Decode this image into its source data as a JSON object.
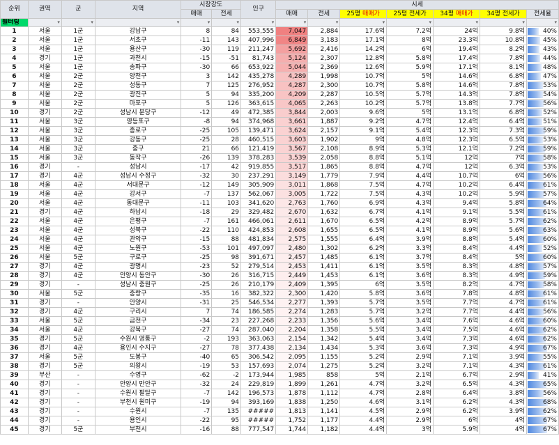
{
  "headers": {
    "rank": "순위",
    "region": "권역",
    "tier": "군",
    "area": "지역",
    "strength": "시장강도",
    "strength_sale": "매매",
    "strength_jeonse": "전세",
    "population": "인구",
    "price": "시세",
    "price_sale": "매매",
    "price_jeonse": "전세",
    "p25_sale_a": "25평 ",
    "p25_sale_b": "매매가",
    "p25_jeonse_a": "25평 ",
    "p25_jeonse_b": "전세가",
    "p34_sale_a": "34평 ",
    "p34_sale_b": "매매가",
    "p34_jeonse_a": "34평 ",
    "p34_jeonse_b": "전세가",
    "ratio": "전세율"
  },
  "filter_label": "필터링",
  "filter_arrow": "▾",
  "colors": {
    "header_bg": "#dfe3ea",
    "yellow": "#ffff00",
    "red_text": "#e00000",
    "filter_green": "#00d96a",
    "bar_blue": "#4f88e0",
    "heat_max": "#f08080",
    "heat_min": "#ffffff"
  },
  "rows": [
    {
      "rank": "1",
      "region": "서울",
      "tier": "1군",
      "area": "강남구",
      "s_sale": "8",
      "s_jeonse": "84",
      "pop": "553,555",
      "sale": "7,047",
      "jeonse": "2,884",
      "p25s": "17.6억",
      "p25j": "7.2억",
      "p34s": "24억",
      "p34j": "9.8억",
      "ratio": "40%",
      "ratio_v": 40,
      "sale_v": 7047
    },
    {
      "rank": "2",
      "region": "서울",
      "tier": "1군",
      "area": "서초구",
      "s_sale": "-11",
      "s_jeonse": "143",
      "pop": "407,996",
      "sale": "6,849",
      "jeonse": "3,183",
      "p25s": "17.1억",
      "p25j": "8억",
      "p34s": "23.3억",
      "p34j": "10.8억",
      "ratio": "45%",
      "ratio_v": 45,
      "sale_v": 6849
    },
    {
      "rank": "3",
      "region": "서울",
      "tier": "1군",
      "area": "용산구",
      "s_sale": "-30",
      "s_jeonse": "119",
      "pop": "211,247",
      "sale": "5,692",
      "jeonse": "2,416",
      "p25s": "14.2억",
      "p25j": "6억",
      "p34s": "19.4억",
      "p34j": "8.2억",
      "ratio": "43%",
      "ratio_v": 43,
      "sale_v": 5692
    },
    {
      "rank": "4",
      "region": "경기",
      "tier": "1군",
      "area": "과천시",
      "s_sale": "-15",
      "s_jeonse": "-51",
      "pop": "81,743",
      "sale": "5,124",
      "jeonse": "2,307",
      "p25s": "12.8억",
      "p25j": "5.8억",
      "p34s": "17.4억",
      "p34j": "7.8억",
      "ratio": "44%",
      "ratio_v": 44,
      "sale_v": 5124
    },
    {
      "rank": "5",
      "region": "서울",
      "tier": "1군",
      "area": "송파구",
      "s_sale": "-30",
      "s_jeonse": "66",
      "pop": "653,922",
      "sale": "5,044",
      "jeonse": "2,369",
      "p25s": "12.6억",
      "p25j": "5.9억",
      "p34s": "17.1억",
      "p34j": "8.1억",
      "ratio": "48%",
      "ratio_v": 48,
      "sale_v": 5044
    },
    {
      "rank": "6",
      "region": "서울",
      "tier": "2군",
      "area": "양천구",
      "s_sale": "3",
      "s_jeonse": "142",
      "pop": "435,278",
      "sale": "4,289",
      "jeonse": "1,998",
      "p25s": "10.7억",
      "p25j": "5억",
      "p34s": "14.6억",
      "p34j": "6.8억",
      "ratio": "47%",
      "ratio_v": 47,
      "sale_v": 4289
    },
    {
      "rank": "7",
      "region": "서울",
      "tier": "2군",
      "area": "성동구",
      "s_sale": "7",
      "s_jeonse": "125",
      "pop": "276,952",
      "sale": "4,287",
      "jeonse": "2,300",
      "p25s": "10.7억",
      "p25j": "5.8억",
      "p34s": "14.6억",
      "p34j": "7.8억",
      "ratio": "53%",
      "ratio_v": 53,
      "sale_v": 4287
    },
    {
      "rank": "8",
      "region": "서울",
      "tier": "2군",
      "area": "광진구",
      "s_sale": "5",
      "s_jeonse": "94",
      "pop": "335,200",
      "sale": "4,209",
      "jeonse": "2,287",
      "p25s": "10.5억",
      "p25j": "5.7억",
      "p34s": "14.3억",
      "p34j": "7.8억",
      "ratio": "54%",
      "ratio_v": 54,
      "sale_v": 4209
    },
    {
      "rank": "9",
      "region": "서울",
      "tier": "2군",
      "area": "마포구",
      "s_sale": "5",
      "s_jeonse": "126",
      "pop": "363,615",
      "sale": "4,065",
      "jeonse": "2,263",
      "p25s": "10.2억",
      "p25j": "5.7억",
      "p34s": "13.8억",
      "p34j": "7.7억",
      "ratio": "56%",
      "ratio_v": 56,
      "sale_v": 4065
    },
    {
      "rank": "10",
      "region": "경기",
      "tier": "2군",
      "area": "성남시 분당구",
      "s_sale": "-12",
      "s_jeonse": "49",
      "pop": "472,385",
      "sale": "3,844",
      "jeonse": "2,003",
      "p25s": "9.6억",
      "p25j": "5억",
      "p34s": "13.1억",
      "p34j": "6.8억",
      "ratio": "52%",
      "ratio_v": 52,
      "sale_v": 3844
    },
    {
      "rank": "11",
      "region": "서울",
      "tier": "3군",
      "area": "영등포구",
      "s_sale": "-8",
      "s_jeonse": "94",
      "pop": "374,968",
      "sale": "3,661",
      "jeonse": "1,887",
      "p25s": "9.2억",
      "p25j": "4.7억",
      "p34s": "12.4억",
      "p34j": "6.4억",
      "ratio": "51%",
      "ratio_v": 51,
      "sale_v": 3661
    },
    {
      "rank": "12",
      "region": "서울",
      "tier": "3군",
      "area": "종로구",
      "s_sale": "-25",
      "s_jeonse": "105",
      "pop": "139,471",
      "sale": "3,624",
      "jeonse": "2,157",
      "p25s": "9.1억",
      "p25j": "5.4억",
      "p34s": "12.3억",
      "p34j": "7.3억",
      "ratio": "59%",
      "ratio_v": 59,
      "sale_v": 3624
    },
    {
      "rank": "13",
      "region": "서울",
      "tier": "3군",
      "area": "강동구",
      "s_sale": "-25",
      "s_jeonse": "28",
      "pop": "460,515",
      "sale": "3,603",
      "jeonse": "1,902",
      "p25s": "9억",
      "p25j": "4.8억",
      "p34s": "12.3억",
      "p34j": "6.5억",
      "ratio": "53%",
      "ratio_v": 53,
      "sale_v": 3603
    },
    {
      "rank": "14",
      "region": "서울",
      "tier": "3군",
      "area": "중구",
      "s_sale": "21",
      "s_jeonse": "66",
      "pop": "121,419",
      "sale": "3,567",
      "jeonse": "2,108",
      "p25s": "8.9억",
      "p25j": "5.3억",
      "p34s": "12.1억",
      "p34j": "7.2억",
      "ratio": "59%",
      "ratio_v": 59,
      "sale_v": 3567
    },
    {
      "rank": "15",
      "region": "서울",
      "tier": "3군",
      "area": "동작구",
      "s_sale": "-26",
      "s_jeonse": "139",
      "pop": "378,283",
      "sale": "3,539",
      "jeonse": "2,058",
      "p25s": "8.8억",
      "p25j": "5.1억",
      "p34s": "12억",
      "p34j": "7억",
      "ratio": "58%",
      "ratio_v": 58,
      "sale_v": 3539
    },
    {
      "rank": "16",
      "region": "경기",
      "tier": "-",
      "area": "성남시",
      "s_sale": "-17",
      "s_jeonse": "42",
      "pop": "919,855",
      "sale": "3,517",
      "jeonse": "1,865",
      "p25s": "8.8억",
      "p25j": "4.7억",
      "p34s": "12억",
      "p34j": "6.3억",
      "ratio": "53%",
      "ratio_v": 53,
      "sale_v": 3517
    },
    {
      "rank": "17",
      "region": "경기",
      "tier": "4군",
      "area": "성남시 수정구",
      "s_sale": "-32",
      "s_jeonse": "30",
      "pop": "237,291",
      "sale": "3,149",
      "jeonse": "1,779",
      "p25s": "7.9억",
      "p25j": "4.4억",
      "p34s": "10.7억",
      "p34j": "6억",
      "ratio": "56%",
      "ratio_v": 56,
      "sale_v": 3149
    },
    {
      "rank": "18",
      "region": "서울",
      "tier": "4군",
      "area": "서대문구",
      "s_sale": "-12",
      "s_jeonse": "149",
      "pop": "305,909",
      "sale": "3,011",
      "jeonse": "1,868",
      "p25s": "7.5억",
      "p25j": "4.7억",
      "p34s": "10.2억",
      "p34j": "6.4억",
      "ratio": "61%",
      "ratio_v": 61,
      "sale_v": 3011
    },
    {
      "rank": "19",
      "region": "서울",
      "tier": "4군",
      "area": "강서구",
      "s_sale": "-7",
      "s_jeonse": "137",
      "pop": "562,067",
      "sale": "3,005",
      "jeonse": "1,722",
      "p25s": "7.5억",
      "p25j": "4.3억",
      "p34s": "10.2억",
      "p34j": "5.9억",
      "ratio": "57%",
      "ratio_v": 57,
      "sale_v": 3005
    },
    {
      "rank": "20",
      "region": "서울",
      "tier": "4군",
      "area": "동대문구",
      "s_sale": "-11",
      "s_jeonse": "103",
      "pop": "341,620",
      "sale": "2,763",
      "jeonse": "1,760",
      "p25s": "6.9억",
      "p25j": "4.3억",
      "p34s": "9.4억",
      "p34j": "5.8억",
      "ratio": "64%",
      "ratio_v": 64,
      "sale_v": 2763
    },
    {
      "rank": "21",
      "region": "경기",
      "tier": "4군",
      "area": "하남시",
      "s_sale": "-18",
      "s_jeonse": "29",
      "pop": "329,482",
      "sale": "2,670",
      "jeonse": "1,632",
      "p25s": "6.7억",
      "p25j": "4.1억",
      "p34s": "9.1억",
      "p34j": "5.5억",
      "ratio": "61%",
      "ratio_v": 61,
      "sale_v": 2670
    },
    {
      "rank": "22",
      "region": "서울",
      "tier": "4군",
      "area": "은평구",
      "s_sale": "-7",
      "s_jeonse": "161",
      "pop": "466,061",
      "sale": "2,611",
      "jeonse": "1,670",
      "p25s": "6.5억",
      "p25j": "4.2억",
      "p34s": "8.9억",
      "p34j": "5.7억",
      "ratio": "62%",
      "ratio_v": 62,
      "sale_v": 2611
    },
    {
      "rank": "23",
      "region": "서울",
      "tier": "4군",
      "area": "성북구",
      "s_sale": "-22",
      "s_jeonse": "110",
      "pop": "424,853",
      "sale": "2,608",
      "jeonse": "1,655",
      "p25s": "6.5억",
      "p25j": "4.1억",
      "p34s": "8.9억",
      "p34j": "5.6억",
      "ratio": "63%",
      "ratio_v": 63,
      "sale_v": 2608
    },
    {
      "rank": "24",
      "region": "서울",
      "tier": "4군",
      "area": "관악구",
      "s_sale": "-15",
      "s_jeonse": "88",
      "pop": "481,834",
      "sale": "2,575",
      "jeonse": "1,555",
      "p25s": "6.4억",
      "p25j": "3.9억",
      "p34s": "8.8억",
      "p34j": "5.4억",
      "ratio": "60%",
      "ratio_v": 60,
      "sale_v": 2575
    },
    {
      "rank": "25",
      "region": "서울",
      "tier": "4군",
      "area": "노원구",
      "s_sale": "-53",
      "s_jeonse": "101",
      "pop": "497,097",
      "sale": "2,480",
      "jeonse": "1,302",
      "p25s": "6.2억",
      "p25j": "3.3억",
      "p34s": "8.4억",
      "p34j": "4.4억",
      "ratio": "52%",
      "ratio_v": 52,
      "sale_v": 2480
    },
    {
      "rank": "26",
      "region": "서울",
      "tier": "5군",
      "area": "구로구",
      "s_sale": "-25",
      "s_jeonse": "98",
      "pop": "391,671",
      "sale": "2,457",
      "jeonse": "1,485",
      "p25s": "6.1억",
      "p25j": "3.7억",
      "p34s": "8.4억",
      "p34j": "5억",
      "ratio": "60%",
      "ratio_v": 60,
      "sale_v": 2457
    },
    {
      "rank": "27",
      "region": "경기",
      "tier": "4군",
      "area": "광명시",
      "s_sale": "-23",
      "s_jeonse": "52",
      "pop": "279,514",
      "sale": "2,453",
      "jeonse": "1,411",
      "p25s": "6.1억",
      "p25j": "3.5억",
      "p34s": "8.3억",
      "p34j": "4.8억",
      "ratio": "57%",
      "ratio_v": 57,
      "sale_v": 2453
    },
    {
      "rank": "28",
      "region": "경기",
      "tier": "4군",
      "area": "안양시 동안구",
      "s_sale": "-30",
      "s_jeonse": "26",
      "pop": "316,715",
      "sale": "2,449",
      "jeonse": "1,453",
      "p25s": "6.1억",
      "p25j": "3.6억",
      "p34s": "8.3억",
      "p34j": "4.9억",
      "ratio": "59%",
      "ratio_v": 59,
      "sale_v": 2449
    },
    {
      "rank": "29",
      "region": "경기",
      "tier": "-",
      "area": "성남시 중원구",
      "s_sale": "-25",
      "s_jeonse": "26",
      "pop": "210,179",
      "sale": "2,409",
      "jeonse": "1,395",
      "p25s": "6억",
      "p25j": "3.5억",
      "p34s": "8.2억",
      "p34j": "4.7억",
      "ratio": "58%",
      "ratio_v": 58,
      "sale_v": 2409
    },
    {
      "rank": "30",
      "region": "서울",
      "tier": "5군",
      "area": "중랑구",
      "s_sale": "-35",
      "s_jeonse": "16",
      "pop": "382,322",
      "sale": "2,300",
      "jeonse": "1,420",
      "p25s": "5.8억",
      "p25j": "3.6억",
      "p34s": "7.8억",
      "p34j": "4.8억",
      "ratio": "61%",
      "ratio_v": 61,
      "sale_v": 2300
    },
    {
      "rank": "31",
      "region": "경기",
      "tier": "-",
      "area": "안양시",
      "s_sale": "-31",
      "s_jeonse": "25",
      "pop": "546,534",
      "sale": "2,277",
      "jeonse": "1,393",
      "p25s": "5.7억",
      "p25j": "3.5억",
      "p34s": "7.7억",
      "p34j": "4.7억",
      "ratio": "61%",
      "ratio_v": 61,
      "sale_v": 2277
    },
    {
      "rank": "32",
      "region": "경기",
      "tier": "4군",
      "area": "구리시",
      "s_sale": "7",
      "s_jeonse": "74",
      "pop": "186,585",
      "sale": "2,274",
      "jeonse": "1,283",
      "p25s": "5.7억",
      "p25j": "3.2억",
      "p34s": "7.7억",
      "p34j": "4.4억",
      "ratio": "56%",
      "ratio_v": 56,
      "sale_v": 2274
    },
    {
      "rank": "33",
      "region": "서울",
      "tier": "5군",
      "area": "금천구",
      "s_sale": "-34",
      "s_jeonse": "23",
      "pop": "227,268",
      "sale": "2,233",
      "jeonse": "1,356",
      "p25s": "5.6억",
      "p25j": "3.4억",
      "p34s": "7.6억",
      "p34j": "4.6억",
      "ratio": "60%",
      "ratio_v": 60,
      "sale_v": 2233
    },
    {
      "rank": "34",
      "region": "서울",
      "tier": "4군",
      "area": "강북구",
      "s_sale": "-27",
      "s_jeonse": "74",
      "pop": "287,040",
      "sale": "2,204",
      "jeonse": "1,358",
      "p25s": "5.5억",
      "p25j": "3.4억",
      "p34s": "7.5억",
      "p34j": "4.6억",
      "ratio": "62%",
      "ratio_v": 62,
      "sale_v": 2204
    },
    {
      "rank": "35",
      "region": "경기",
      "tier": "5군",
      "area": "수원시 영통구",
      "s_sale": "-2",
      "s_jeonse": "193",
      "pop": "363,063",
      "sale": "2,154",
      "jeonse": "1,342",
      "p25s": "5.4억",
      "p25j": "3.4억",
      "p34s": "7.3억",
      "p34j": "4.6억",
      "ratio": "62%",
      "ratio_v": 62,
      "sale_v": 2154
    },
    {
      "rank": "36",
      "region": "경기",
      "tier": "4군",
      "area": "용인시 수지구",
      "s_sale": "-27",
      "s_jeonse": "78",
      "pop": "377,438",
      "sale": "2,134",
      "jeonse": "1,434",
      "p25s": "5.3억",
      "p25j": "3.6억",
      "p34s": "7.3억",
      "p34j": "4.9억",
      "ratio": "67%",
      "ratio_v": 67,
      "sale_v": 2134
    },
    {
      "rank": "37",
      "region": "서울",
      "tier": "5군",
      "area": "도봉구",
      "s_sale": "-40",
      "s_jeonse": "65",
      "pop": "306,542",
      "sale": "2,095",
      "jeonse": "1,155",
      "p25s": "5.2억",
      "p25j": "2.9억",
      "p34s": "7.1억",
      "p34j": "3.9억",
      "ratio": "55%",
      "ratio_v": 55,
      "sale_v": 2095
    },
    {
      "rank": "38",
      "region": "경기",
      "tier": "5군",
      "area": "의왕시",
      "s_sale": "-19",
      "s_jeonse": "53",
      "pop": "157,693",
      "sale": "2,074",
      "jeonse": "1,275",
      "p25s": "5.2억",
      "p25j": "3.2억",
      "p34s": "7.1억",
      "p34j": "4.3억",
      "ratio": "61%",
      "ratio_v": 61,
      "sale_v": 2074
    },
    {
      "rank": "39",
      "region": "부산",
      "tier": "-",
      "area": "수영구",
      "s_sale": "-62",
      "s_jeonse": "-2",
      "pop": "173,944",
      "sale": "1,985",
      "jeonse": "858",
      "p25s": "5억",
      "p25j": "2.1억",
      "p34s": "6.7억",
      "p34j": "2.9억",
      "ratio": "41%",
      "ratio_v": 41,
      "sale_v": 1985
    },
    {
      "rank": "40",
      "region": "경기",
      "tier": "-",
      "area": "안양시 만안구",
      "s_sale": "-32",
      "s_jeonse": "24",
      "pop": "229,819",
      "sale": "1,899",
      "jeonse": "1,261",
      "p25s": "4.7억",
      "p25j": "3.2억",
      "p34s": "6.5억",
      "p34j": "4.3억",
      "ratio": "65%",
      "ratio_v": 65,
      "sale_v": 1899
    },
    {
      "rank": "41",
      "region": "경기",
      "tier": "-",
      "area": "수원시 팔달구",
      "s_sale": "-7",
      "s_jeonse": "142",
      "pop": "196,573",
      "sale": "1,878",
      "jeonse": "1,112",
      "p25s": "4.7억",
      "p25j": "2.8억",
      "p34s": "6.4억",
      "p34j": "3.8억",
      "ratio": "56%",
      "ratio_v": 56,
      "sale_v": 1878
    },
    {
      "rank": "42",
      "region": "경기",
      "tier": "-",
      "area": "부천시 원미구",
      "s_sale": "-19",
      "s_jeonse": "94",
      "pop": "393,169",
      "sale": "1,838",
      "jeonse": "1,250",
      "p25s": "4.6억",
      "p25j": "3.1억",
      "p34s": "6.2억",
      "p34j": "4.3억",
      "ratio": "68%",
      "ratio_v": 68,
      "sale_v": 1838
    },
    {
      "rank": "43",
      "region": "경기",
      "tier": "-",
      "area": "수원시",
      "s_sale": "-7",
      "s_jeonse": "135",
      "pop": "#####",
      "sale": "1,813",
      "jeonse": "1,141",
      "p25s": "4.5억",
      "p25j": "2.9억",
      "p34s": "6.2억",
      "p34j": "3.9억",
      "ratio": "62%",
      "ratio_v": 62,
      "sale_v": 1813
    },
    {
      "rank": "44",
      "region": "경기",
      "tier": "-",
      "area": "용인시",
      "s_sale": "-22",
      "s_jeonse": "95",
      "pop": "#####",
      "sale": "1,752",
      "jeonse": "1,177",
      "p25s": "4.4억",
      "p25j": "2.9억",
      "p34s": "6억",
      "p34j": "4억",
      "ratio": "67%",
      "ratio_v": 67,
      "sale_v": 1752
    },
    {
      "rank": "45",
      "region": "경기",
      "tier": "5군",
      "area": "부천시",
      "s_sale": "-16",
      "s_jeonse": "88",
      "pop": "777,547",
      "sale": "1,744",
      "jeonse": "1,182",
      "p25s": "4.4억",
      "p25j": "3억",
      "p34s": "5.9억",
      "p34j": "4억",
      "ratio": "67%",
      "ratio_v": 67,
      "sale_v": 1744
    }
  ]
}
